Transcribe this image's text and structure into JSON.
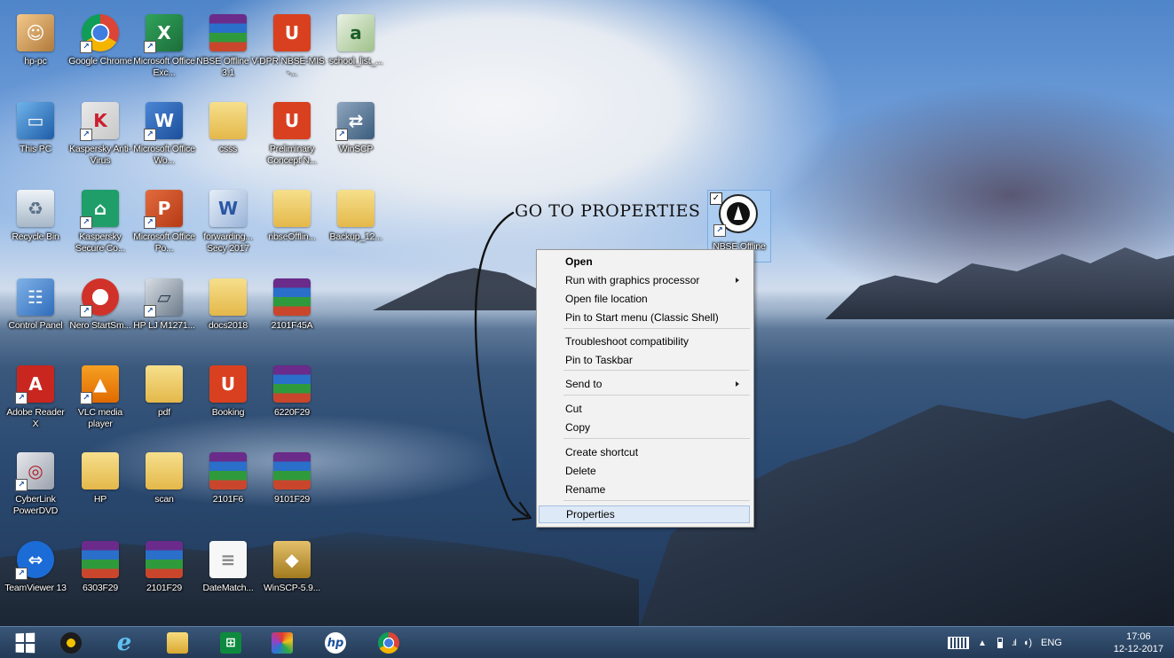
{
  "desktop": {
    "icons": [
      {
        "label": "hp-pc",
        "icon": "user-folder-icon"
      },
      {
        "label": "Google Chrome",
        "icon": "chrome-icon"
      },
      {
        "label": "Microsoft Office Exc...",
        "icon": "excel-icon"
      },
      {
        "label": "NBSE Offline V-3.1",
        "icon": "winrar-archive-icon"
      },
      {
        "label": "DPR NBSE-MIS -...",
        "icon": "pdf-icon"
      },
      {
        "label": "school_list_...",
        "icon": "excel-doc-icon"
      },
      {
        "label": "This PC",
        "icon": "computer-icon"
      },
      {
        "label": "Kaspersky Anti-Virus",
        "icon": "kaspersky-icon"
      },
      {
        "label": "Microsoft Office Wo...",
        "icon": "word-icon"
      },
      {
        "label": "csss",
        "icon": "folder-icon"
      },
      {
        "label": "Preliminary Concept N...",
        "icon": "pdf-icon"
      },
      {
        "label": "WinSCP",
        "icon": "winscp-icon"
      },
      {
        "label": "Recycle Bin",
        "icon": "recycle-bin-icon"
      },
      {
        "label": "Kaspersky Secure Co...",
        "icon": "kaspersky-secure-icon"
      },
      {
        "label": "Microsoft Office Po...",
        "icon": "powerpoint-icon"
      },
      {
        "label": "forwarding... Secy 2017",
        "icon": "word-doc-icon"
      },
      {
        "label": "nbseOfflin...",
        "icon": "folder-icon"
      },
      {
        "label": "Backup_12...",
        "icon": "folder-icon"
      },
      {
        "label": "Control Panel",
        "icon": "control-panel-icon"
      },
      {
        "label": "Nero StartSm...",
        "icon": "nero-icon"
      },
      {
        "label": "HP LJ M1271...",
        "icon": "scanner-icon"
      },
      {
        "label": "docs2018",
        "icon": "folder-icon"
      },
      {
        "label": "2101F45A",
        "icon": "winrar-archive-icon"
      },
      {
        "label": "Adobe Reader X",
        "icon": "adobe-reader-icon"
      },
      {
        "label": "VLC media player",
        "icon": "vlc-icon"
      },
      {
        "label": "pdf",
        "icon": "folder-icon"
      },
      {
        "label": "Booking",
        "icon": "pdf-icon"
      },
      {
        "label": "6220F29",
        "icon": "winrar-archive-icon"
      },
      {
        "label": "CyberLink PowerDVD",
        "icon": "powerdvd-icon"
      },
      {
        "label": "HP",
        "icon": "folder-icon"
      },
      {
        "label": "scan",
        "icon": "folder-icon"
      },
      {
        "label": "2101F6",
        "icon": "winrar-archive-icon"
      },
      {
        "label": "9101F29",
        "icon": "winrar-archive-icon"
      },
      {
        "label": "TeamViewer 13",
        "icon": "teamviewer-icon"
      },
      {
        "label": "6303F29",
        "icon": "winrar-archive-icon"
      },
      {
        "label": "2101F29",
        "icon": "winrar-archive-icon"
      },
      {
        "label": "DateMatch...",
        "icon": "text-file-icon"
      },
      {
        "label": "WinSCP-5.9...",
        "icon": "winscp-setup-icon"
      }
    ],
    "selected_icon": {
      "label": "NBSE Offline",
      "icon": "nbse-logo-icon"
    },
    "annotation": {
      "text": "GO TO PROPERTIES"
    }
  },
  "context_menu": {
    "items": [
      {
        "label": "Open",
        "bold": true
      },
      {
        "label": "Run with graphics processor",
        "submenu": true
      },
      {
        "label": "Open file location"
      },
      {
        "label": "Pin to Start menu (Classic Shell)"
      },
      {
        "label": "Troubleshoot compatibility"
      },
      {
        "label": "Pin to Taskbar"
      },
      {
        "label": "Send to",
        "submenu": true
      },
      {
        "label": "Cut"
      },
      {
        "label": "Copy"
      },
      {
        "label": "Create shortcut"
      },
      {
        "label": "Delete"
      },
      {
        "label": "Rename"
      },
      {
        "label": "Properties",
        "highlighted": true
      }
    ]
  },
  "taskbar": {
    "pinned": [
      {
        "name": "start-button",
        "icon": "windows-logo-icon"
      },
      {
        "name": "media-player-button",
        "icon": "speaker-disc-icon"
      },
      {
        "name": "internet-explorer-button",
        "icon": "ie-icon"
      },
      {
        "name": "file-explorer-button",
        "icon": "folder-icon"
      },
      {
        "name": "store-button",
        "icon": "store-bag-icon"
      },
      {
        "name": "paint-button",
        "icon": "paint-icon"
      },
      {
        "name": "hp-button",
        "icon": "hp-logo-icon"
      },
      {
        "name": "chrome-button",
        "icon": "chrome-icon"
      }
    ],
    "tray": {
      "language": "ENG",
      "time": "17:06",
      "date": "12-12-2017"
    }
  },
  "colors": {
    "taskbar": "#2d4766",
    "menu_bg": "#f2f2f2",
    "menu_highlight": "#dde9f6",
    "selection": "#add1f5"
  }
}
